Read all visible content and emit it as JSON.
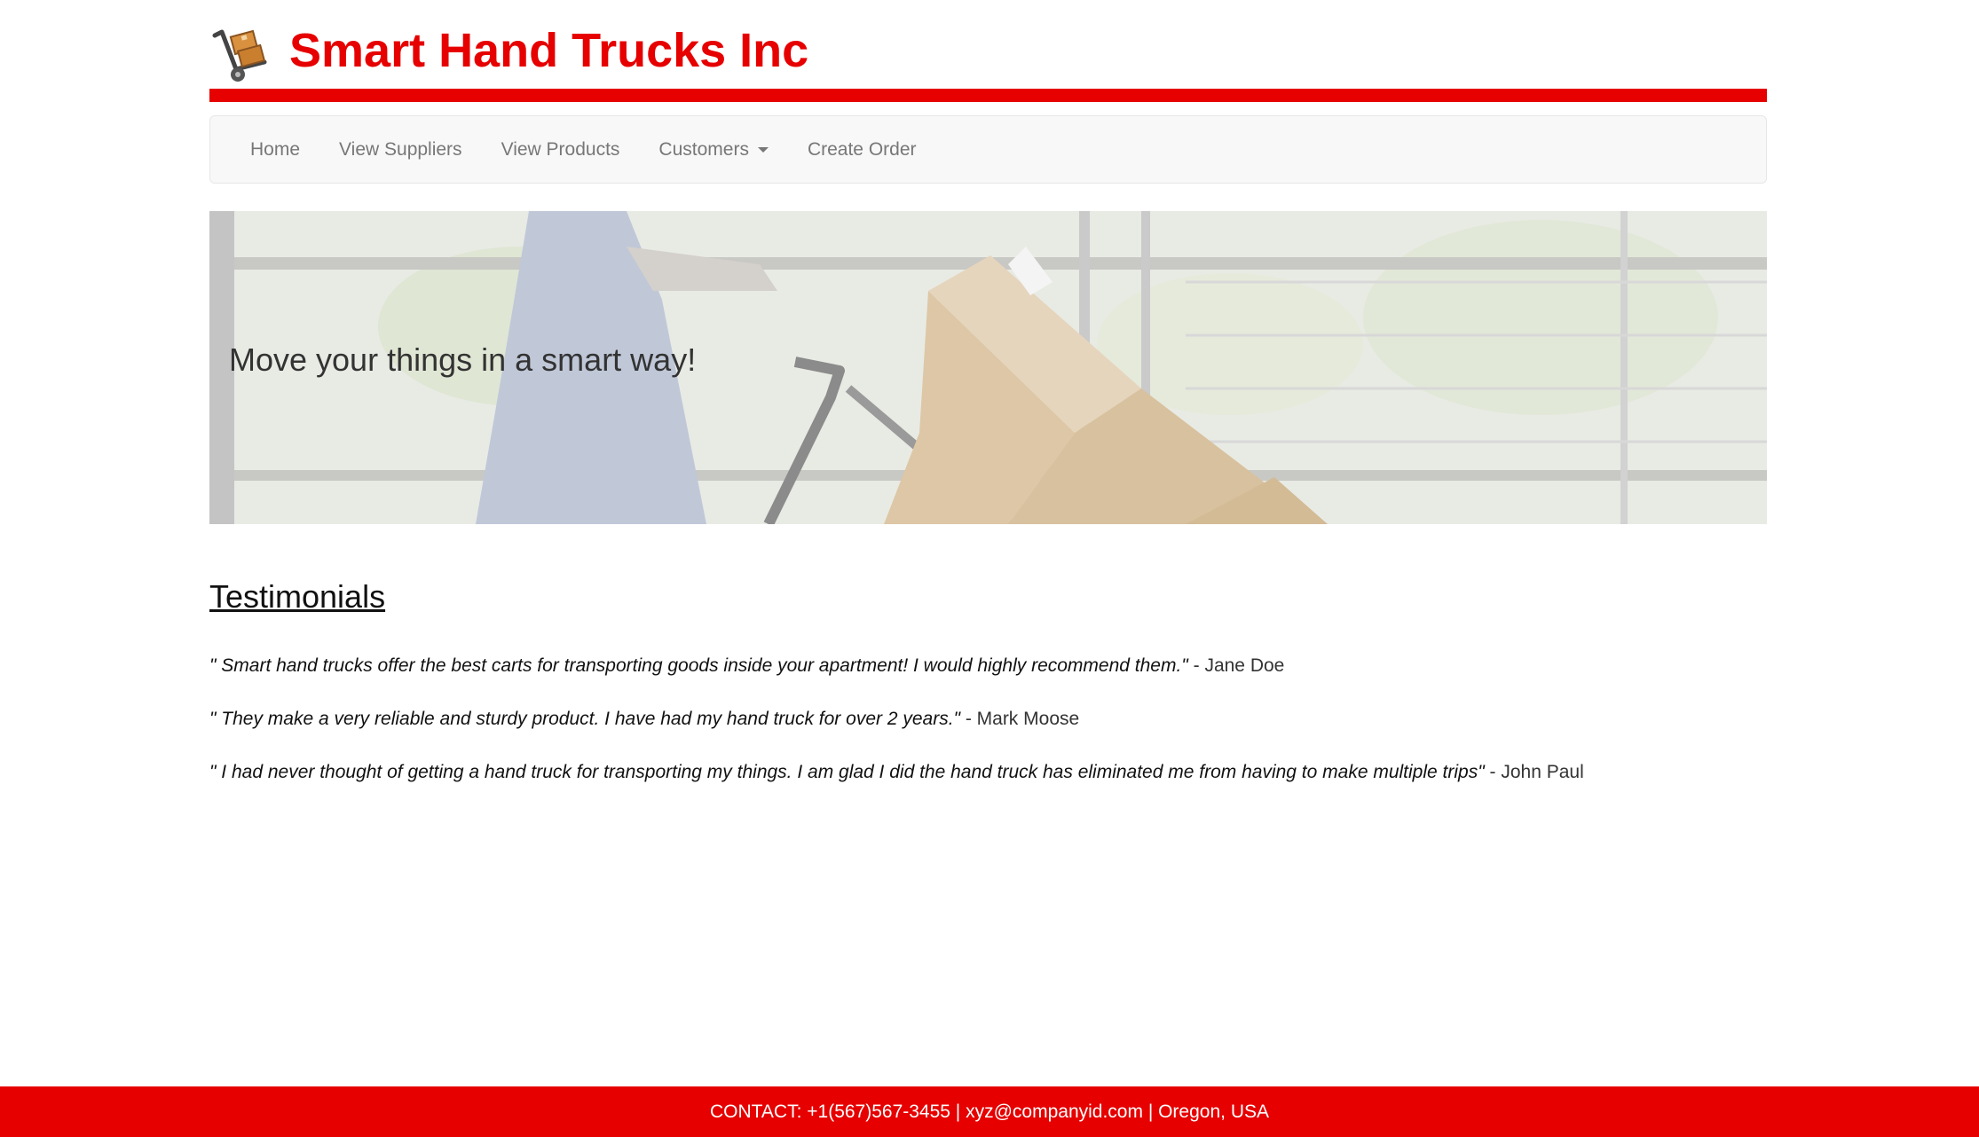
{
  "header": {
    "title": "Smart Hand Trucks Inc",
    "logo_icon": "hand-truck-icon",
    "brand_color": "#e60000"
  },
  "nav": {
    "items": [
      {
        "label": "Home"
      },
      {
        "label": "View Suppliers"
      },
      {
        "label": "View Products"
      },
      {
        "label": "Customers",
        "has_dropdown": true
      },
      {
        "label": "Create Order"
      }
    ]
  },
  "hero": {
    "text": "Move your things in a smart way!"
  },
  "testimonials": {
    "title": "Testimonials",
    "items": [
      {
        "quote": "\" Smart hand trucks offer the best carts for transporting goods inside your apartment! I would highly recommend them.\"",
        "author": " - Jane Doe"
      },
      {
        "quote": "\" They make a very reliable and sturdy product. I have had my hand truck for over 2 years.\"",
        "author": " - Mark Moose"
      },
      {
        "quote": "\" I had never thought of getting a hand truck for transporting my things. I am glad I did the hand truck has eliminated me from having to make multiple trips\"",
        "author": " - John Paul"
      }
    ]
  },
  "footer": {
    "text": "CONTACT: +1(567)567-3455 | xyz@companyid.com | Oregon, USA"
  }
}
